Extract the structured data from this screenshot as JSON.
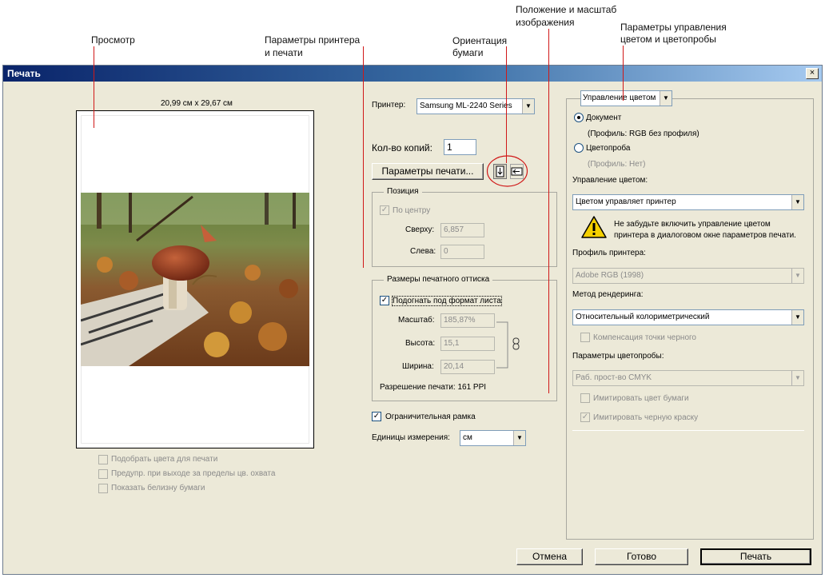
{
  "annotations": {
    "preview": "Просмотр",
    "printer_params": [
      "Параметры принтера",
      "и печати"
    ],
    "orientation": [
      "Ориентация",
      "бумаги"
    ],
    "position_scale": [
      "Положение и масштаб",
      "изображения"
    ],
    "color_params": [
      "Параметры управления",
      "цветом и цветопробы"
    ]
  },
  "window": {
    "title": "Печать",
    "close": "×"
  },
  "preview": {
    "paper_size": "20,99 см x 29,67 см",
    "checkboxes": [
      {
        "label": "Подобрать цвета для печати",
        "checked": false
      },
      {
        "label": "Предупр. при выходе за пределы цв. охвата",
        "checked": false
      },
      {
        "label": "Показать белизну бумаги",
        "checked": false
      }
    ]
  },
  "printer": {
    "label": "Принтер:",
    "value": "Samsung ML-2240 Series",
    "copies_label": "Кол-во копий:",
    "copies_value": "1",
    "params_button": "Параметры печати..."
  },
  "position": {
    "title": "Позиция",
    "center_label": "По центру",
    "top_label": "Сверху:",
    "top_value": "6,857",
    "left_label": "Слева:",
    "left_value": "0"
  },
  "print_size": {
    "title": "Размеры печатного оттиска",
    "fit_label": "Подогнать под формат листа",
    "scale_label": "Масштаб:",
    "scale_value": "185,87%",
    "height_label": "Высота:",
    "height_value": "15,1",
    "width_label": "Ширина:",
    "width_value": "20,14",
    "resolution": "Разрешение печати: 161 PPI"
  },
  "bounding_box_label": "Ограничительная рамка",
  "units": {
    "label": "Единицы измерения:",
    "value": "см"
  },
  "color": {
    "mode_select": "Управление цветом",
    "document_label": "Документ",
    "document_profile": "(Профиль: RGB без профиля)",
    "proof_label": "Цветопроба",
    "proof_profile": "(Профиль: Нет)",
    "handling_label": "Управление цветом:",
    "handling_value": "Цветом управляет принтер",
    "warning_line1": "Не забудьте включить управление цветом",
    "warning_line2": "принтера в диалоговом окне параметров печати.",
    "printer_profile_label": "Профиль принтера:",
    "printer_profile_value": "Adobe RGB (1998)",
    "intent_label": "Метод рендеринга:",
    "intent_value": "Относительный колориметрический",
    "bpc_label": "Компенсация точки черного",
    "proof_setup_label": "Параметры цветопробы:",
    "proof_setup_value": "Раб. прост-во CMYK",
    "sim_paper_label": "Имитировать цвет бумаги",
    "sim_black_label": "Имитировать черную краску"
  },
  "buttons": {
    "cancel": "Отмена",
    "done": "Готово",
    "print": "Печать"
  }
}
